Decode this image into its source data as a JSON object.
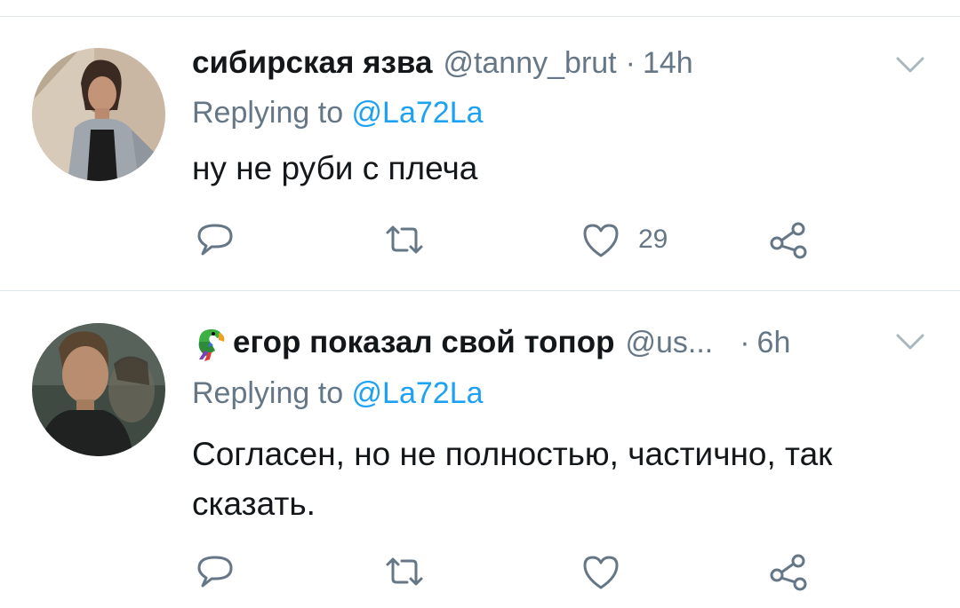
{
  "tweets": [
    {
      "name": "сибирская язва",
      "handle": "@tanny_brut",
      "separator": "·",
      "time": "14h",
      "replying_prefix": "Replying to ",
      "replying_to": "@La72La",
      "text": "ну не руби с плеча",
      "likes": "29",
      "name_emoji": "",
      "avatar_icon": "user-photo"
    },
    {
      "name": "егор показал свой топор",
      "handle": "@us...",
      "separator": "·",
      "time": "6h",
      "replying_prefix": "Replying to ",
      "replying_to": "@La72La",
      "text": "Согласен, но не полностью, частично, так сказать.",
      "likes": "",
      "name_emoji": "parrot-icon",
      "avatar_icon": "user-photo"
    }
  ],
  "colors": {
    "text": "#14171a",
    "secondary": "#657786",
    "link": "#1da1f2",
    "divider": "#e1e8ed"
  },
  "icons": [
    "reply-icon",
    "retweet-icon",
    "like-icon",
    "share-icon",
    "chevron-down-icon"
  ]
}
